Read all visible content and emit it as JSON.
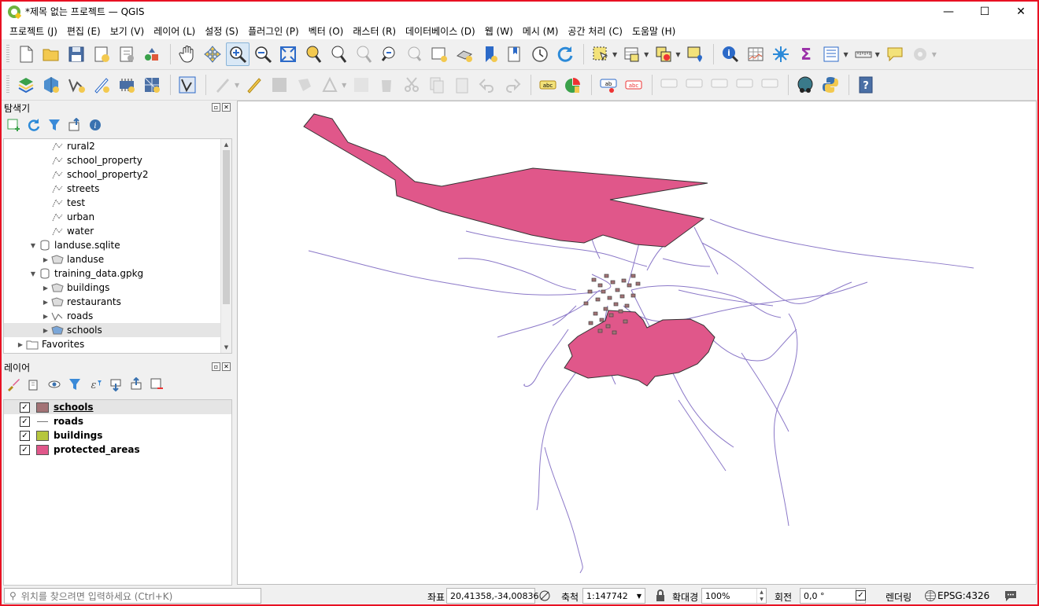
{
  "window": {
    "title": "*제목 없는 프로젝트 — QGIS",
    "minimize": "—",
    "maximize": "☐",
    "close": "✕"
  },
  "menu": [
    "프로젝트 (J)",
    "편집 (E)",
    "보기 (V)",
    "레이어 (L)",
    "설정 (S)",
    "플러그인 (P)",
    "벡터 (O)",
    "래스터 (R)",
    "데이터베이스 (D)",
    "웹 (W)",
    "메시 (M)",
    "공간 처리 (C)",
    "도움말 (H)"
  ],
  "browser": {
    "title": "탐색기",
    "items": [
      {
        "label": "rural2",
        "level": 3,
        "icon": "vector-layer-icon"
      },
      {
        "label": "school_property",
        "level": 3,
        "icon": "vector-layer-icon"
      },
      {
        "label": "school_property2",
        "level": 3,
        "icon": "vector-layer-icon"
      },
      {
        "label": "streets",
        "level": 3,
        "icon": "vector-layer-icon"
      },
      {
        "label": "test",
        "level": 3,
        "icon": "vector-layer-icon"
      },
      {
        "label": "urban",
        "level": 3,
        "icon": "vector-layer-icon"
      },
      {
        "label": "water",
        "level": 3,
        "icon": "vector-layer-icon"
      },
      {
        "label": "landuse.sqlite",
        "level": 2,
        "icon": "database-icon",
        "arrow": "▼"
      },
      {
        "label": "landuse",
        "level": 3,
        "icon": "polygon-layer-icon",
        "arrow": "▶"
      },
      {
        "label": "training_data.gpkg",
        "level": 2,
        "icon": "database-icon",
        "arrow": "▼"
      },
      {
        "label": "buildings",
        "level": 3,
        "icon": "polygon-layer-icon",
        "arrow": "▶"
      },
      {
        "label": "restaurants",
        "level": 3,
        "icon": "polygon-layer-icon",
        "arrow": "▶"
      },
      {
        "label": "roads",
        "level": 3,
        "icon": "line-layer-icon",
        "arrow": "▶"
      },
      {
        "label": "schools",
        "level": 3,
        "icon": "polygon-layer-icon",
        "arrow": "▶",
        "selected": true
      },
      {
        "label": "Favorites",
        "level": 1,
        "icon": "folder-icon",
        "arrow": "▶"
      }
    ]
  },
  "layers": {
    "title": "레이어",
    "items": [
      {
        "label": "schools",
        "checked": "✓",
        "color": "#a37275",
        "type": "polygon",
        "underline": true,
        "selected": true
      },
      {
        "label": "roads",
        "checked": "✓",
        "color": "#7a7a7a",
        "type": "line"
      },
      {
        "label": "buildings",
        "checked": "✓",
        "color": "#b6c63e",
        "type": "polygon"
      },
      {
        "label": "protected_areas",
        "checked": "✓",
        "color": "#e0578a",
        "type": "polygon"
      }
    ]
  },
  "map": {
    "protected_color": "#e0578a",
    "road_color": "#8b78c8",
    "school_color": "#a37275"
  },
  "status": {
    "locator_placeholder": "위치를 찾으려면 입력하세요 (Ctrl+K)",
    "coord_label": "좌표",
    "coord_value": "20,41358,-34,00836",
    "scale_label": "축척",
    "scale_value": "1:147742",
    "magnifier_label": "확대경",
    "magnifier_value": "100%",
    "rotation_label": "회전",
    "rotation_value": "0,0 °",
    "render_label": "렌더링",
    "render_checked": "✓",
    "crs": "EPSG:4326"
  }
}
